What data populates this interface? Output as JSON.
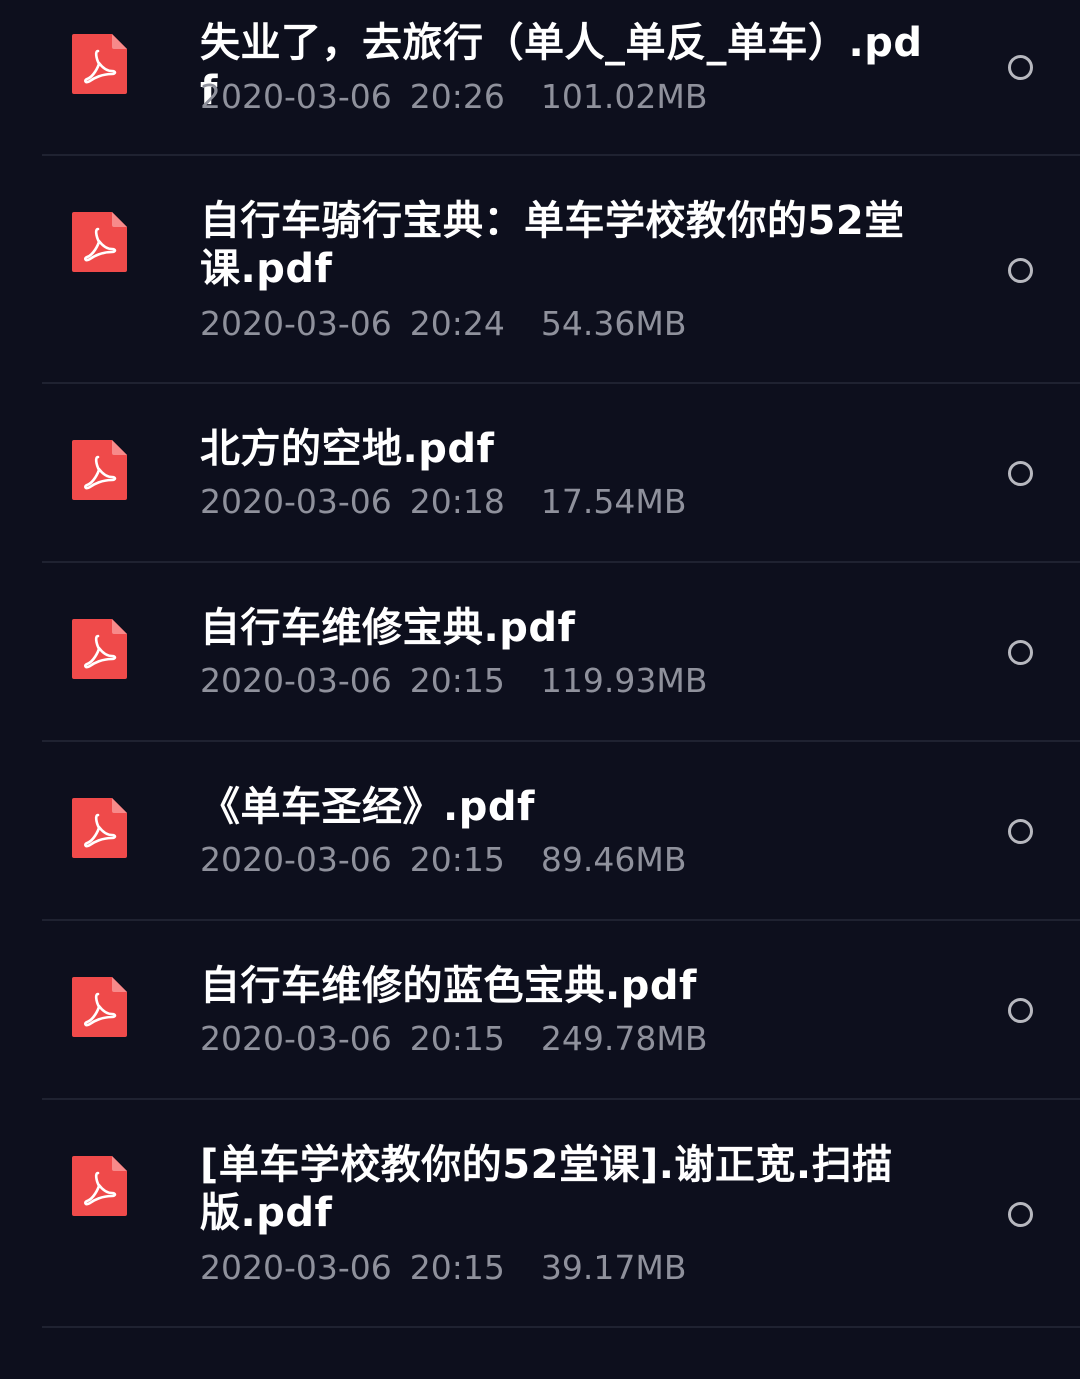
{
  "files": [
    {
      "name": "失业了，去旅行（单人_单反_单车）.pdf",
      "date": "2020-03-06",
      "time": "20:26",
      "size": "101.02MB",
      "icon": "pdf-file-icon",
      "selected": false
    },
    {
      "name": "自行车骑行宝典：单车学校教你的52堂课.pdf",
      "date": "2020-03-06",
      "time": "20:24",
      "size": "54.36MB",
      "icon": "pdf-file-icon",
      "selected": false
    },
    {
      "name": "北方的空地.pdf",
      "date": "2020-03-06",
      "time": "20:18",
      "size": "17.54MB",
      "icon": "pdf-file-icon",
      "selected": false
    },
    {
      "name": "自行车维修宝典.pdf",
      "date": "2020-03-06",
      "time": "20:15",
      "size": "119.93MB",
      "icon": "pdf-file-icon",
      "selected": false
    },
    {
      "name": "《单车圣经》.pdf",
      "date": "2020-03-06",
      "time": "20:15",
      "size": "89.46MB",
      "icon": "pdf-file-icon",
      "selected": false
    },
    {
      "name": "自行车维修的蓝色宝典.pdf",
      "date": "2020-03-06",
      "time": "20:15",
      "size": "249.78MB",
      "icon": "pdf-file-icon",
      "selected": false
    },
    {
      "name": "[单车学校教你的52堂课].谢正宽.扫描版.pdf",
      "date": "2020-03-06",
      "time": "20:15",
      "size": "39.17MB",
      "icon": "pdf-file-icon",
      "selected": false
    }
  ],
  "colors": {
    "background": "#0d0f1d",
    "divider": "#1f2231",
    "pdf_icon": "#ef4a4a",
    "title_text": "#ffffff",
    "meta_text": "#8f919c",
    "radio_border": "#b7b8bf"
  }
}
